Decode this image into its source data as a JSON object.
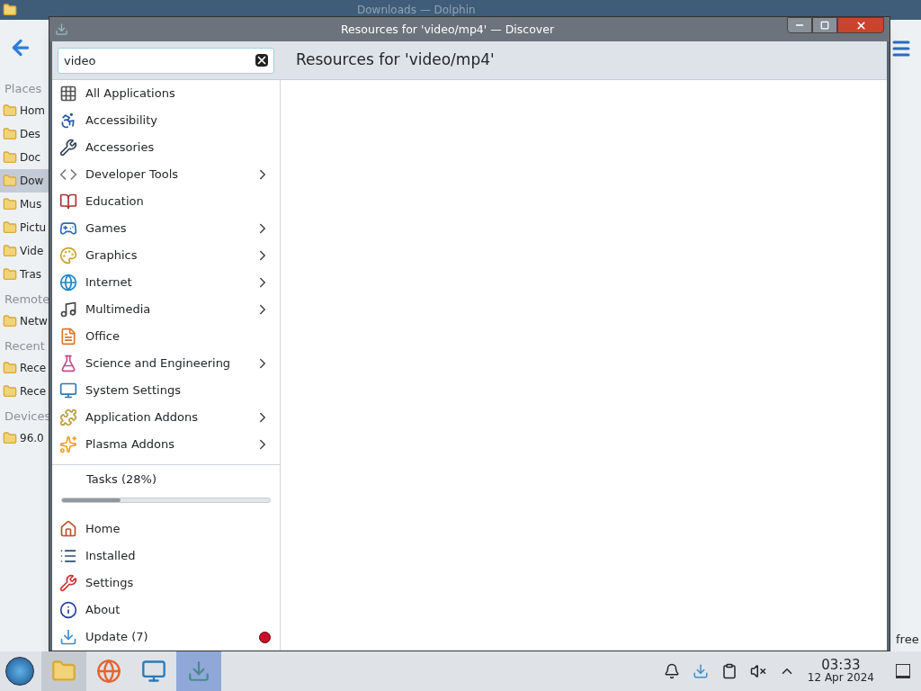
{
  "background_window": {
    "title": "Downloads — Dolphin",
    "sidebar": [
      {
        "kind": "heading",
        "label": "Places"
      },
      {
        "kind": "item",
        "label": "Hom",
        "selected": false
      },
      {
        "kind": "item",
        "label": "Des",
        "selected": false
      },
      {
        "kind": "item",
        "label": "Doc",
        "selected": false
      },
      {
        "kind": "item",
        "label": "Dow",
        "selected": true
      },
      {
        "kind": "item",
        "label": "Mus",
        "selected": false
      },
      {
        "kind": "item",
        "label": "Pictu",
        "selected": false
      },
      {
        "kind": "item",
        "label": "Vide",
        "selected": false
      },
      {
        "kind": "item",
        "label": "Tras",
        "selected": false
      },
      {
        "kind": "heading",
        "label": "Remote"
      },
      {
        "kind": "item",
        "label": "Netw",
        "selected": false
      },
      {
        "kind": "heading",
        "label": "Recent"
      },
      {
        "kind": "item",
        "label": "Rece",
        "selected": false
      },
      {
        "kind": "item",
        "label": "Rece",
        "selected": false
      },
      {
        "kind": "heading",
        "label": "Devices"
      },
      {
        "kind": "item",
        "label": "96.0",
        "selected": false
      }
    ],
    "status_text": "free"
  },
  "window": {
    "title": "Resources for 'video/mp4' — Discover"
  },
  "search": {
    "value": "video"
  },
  "page_title": "Resources for 'video/mp4'",
  "categories": [
    {
      "label": "All Applications",
      "has_submenu": false
    },
    {
      "label": "Accessibility",
      "has_submenu": false
    },
    {
      "label": "Accessories",
      "has_submenu": false
    },
    {
      "label": "Developer Tools",
      "has_submenu": true
    },
    {
      "label": "Education",
      "has_submenu": false
    },
    {
      "label": "Games",
      "has_submenu": true
    },
    {
      "label": "Graphics",
      "has_submenu": true
    },
    {
      "label": "Internet",
      "has_submenu": true
    },
    {
      "label": "Multimedia",
      "has_submenu": true
    },
    {
      "label": "Office",
      "has_submenu": false
    },
    {
      "label": "Science and Engineering",
      "has_submenu": true
    },
    {
      "label": "System Settings",
      "has_submenu": false
    },
    {
      "label": "Application Addons",
      "has_submenu": true
    },
    {
      "label": "Plasma Addons",
      "has_submenu": true
    }
  ],
  "tasks": {
    "label": "Tasks (28%)",
    "level": 0.28
  },
  "nav": [
    {
      "label": "Home",
      "alert": false
    },
    {
      "label": "Installed",
      "alert": false
    },
    {
      "label": "Settings",
      "alert": false
    },
    {
      "label": "About",
      "alert": false
    },
    {
      "label": "Update (7)",
      "alert": true
    }
  ],
  "taskbar": {
    "apps": [
      {
        "selected": true
      },
      {
        "selected": false
      },
      {
        "selected": false
      },
      {
        "selected": true
      }
    ],
    "time": "03:33",
    "date": "12 Apr 2024"
  }
}
